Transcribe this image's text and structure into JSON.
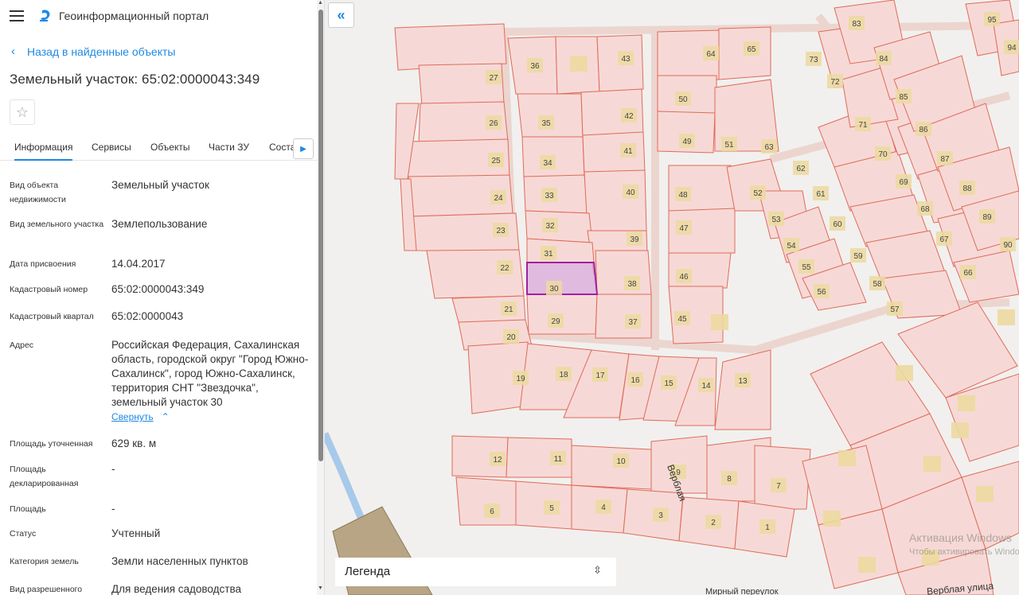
{
  "header": {
    "app_title": "Геоинформационный портал"
  },
  "nav": {
    "back_label": "Назад в найденные объекты"
  },
  "object": {
    "title": "Земельный участок: 65:02:0000043:349"
  },
  "tabs": [
    "Информация",
    "Сервисы",
    "Объекты",
    "Части ЗУ",
    "Соста"
  ],
  "info": [
    {
      "label": "Вид объекта недвижимости",
      "value": "Земельный участок"
    },
    {
      "label": "Вид земельного участка",
      "value": "Землепользование"
    },
    {
      "label": "Дата присвоения",
      "value": "14.04.2017"
    },
    {
      "label": "Кадастровый номер",
      "value": "65:02:0000043:349"
    },
    {
      "label": "Кадастровый квартал",
      "value": "65:02:0000043"
    },
    {
      "label": "Адрес",
      "value": "Российская Федерация, Сахалинская область, городской округ \"Город Южно-Сахалинск\", город Южно-Сахалинск, территория СНТ \"Звездочка\", земельный участок 30"
    },
    {
      "label": "Площадь уточненная",
      "value": "629 кв. м"
    },
    {
      "label": "Площадь декларированная",
      "value": "-"
    },
    {
      "label": "Площадь",
      "value": "-"
    },
    {
      "label": "Статус",
      "value": "Учтенный"
    },
    {
      "label": "Категория земель",
      "value": "Земли населенных пунктов"
    },
    {
      "label": "Вид разрешенного",
      "value": "Для ведения садоводства"
    }
  ],
  "address_toggle": "Свернуть",
  "map": {
    "legend_label": "Легенда",
    "street_names": [
      "Верблая",
      "Верблая улица",
      "Мирный переулок"
    ],
    "parcel_numbers": [
      "1",
      "2",
      "3",
      "4",
      "5",
      "6",
      "7",
      "8",
      "9",
      "10",
      "11",
      "12",
      "13",
      "14",
      "15",
      "16",
      "17",
      "18",
      "19",
      "20",
      "21",
      "22",
      "23",
      "24",
      "25",
      "26",
      "27",
      "29",
      "30",
      "31",
      "32",
      "33",
      "34",
      "35",
      "36",
      "37",
      "38",
      "39",
      "40",
      "41",
      "42",
      "43",
      "45",
      "46",
      "47",
      "48",
      "49",
      "50",
      "51",
      "52",
      "53",
      "54",
      "55",
      "56",
      "57",
      "58",
      "59",
      "60",
      "61",
      "62",
      "63",
      "64",
      "65",
      "66",
      "67",
      "68",
      "69",
      "70",
      "71",
      "72",
      "73",
      "83",
      "84",
      "85",
      "86",
      "87",
      "88",
      "89",
      "90",
      "94",
      "95"
    ],
    "watermark_line1": "Активация Windows",
    "watermark_line2": "Чтобы активировать Windows"
  },
  "colors": {
    "accent": "#1e88e5",
    "parcel_fill": "#f6d9d6",
    "parcel_stroke": "#e06a5a",
    "selected": "#c77cc7"
  }
}
